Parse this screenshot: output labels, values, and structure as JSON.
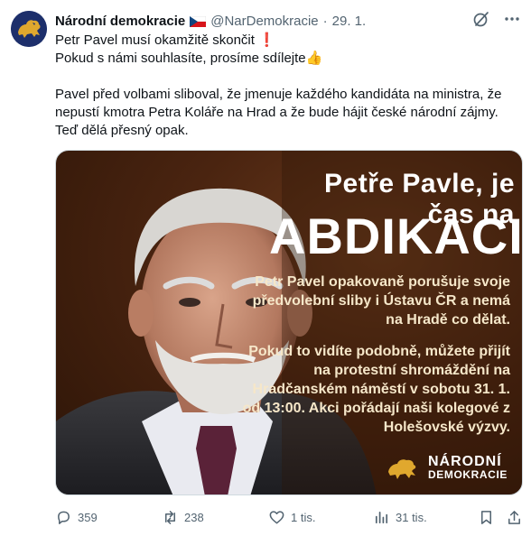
{
  "author": {
    "display_name": "Národní demokracie",
    "handle": "@NarDemokracie",
    "separator": "·",
    "date": "29. 1."
  },
  "tweet": {
    "line1": "Petr Pavel musí okamžitě skončit ❗",
    "line2": "Pokud s námi souhlasíte, prosíme sdílejte👍",
    "paragraph": "Pavel před volbami sliboval, že jmenuje každého kandidáta na ministra, že nepustí kmotra Petra Koláře na Hrad a že bude hájit české národní zájmy. Teď dělá přesný opak."
  },
  "media": {
    "headline_1": "Petře Pavle, je čas na",
    "headline_2": "ABDIKACI!",
    "paragraph_1": "Petr Pavel opakovaně porušuje svoje předvolební sliby i Ústavu ČR a nemá na Hradě co dělat.",
    "paragraph_2": "Pokud to vidíte podobně, můžete přijít na protestní shromáždění na Hradčanském náměstí v sobotu 31. 1. od 13:00. Akci pořádají naši kolegové z Holešovské výzvy.",
    "logo_line_1": "NÁRODNÍ",
    "logo_line_2": "DEMOKRACIE"
  },
  "actions": {
    "replies": "359",
    "reposts": "238",
    "likes": "1 tis.",
    "views": "31 tis."
  },
  "icons": [
    "avatar-lion-icon",
    "czech-flag-icon",
    "grok-icon",
    "more-icon",
    "reply-icon",
    "repost-icon",
    "like-icon",
    "views-icon",
    "bookmark-icon",
    "share-icon"
  ],
  "colors": {
    "text": "#0f1419",
    "secondary": "#536471",
    "avatar_bg": "#1d2f6b",
    "lion_gold": "#e0a82e"
  }
}
